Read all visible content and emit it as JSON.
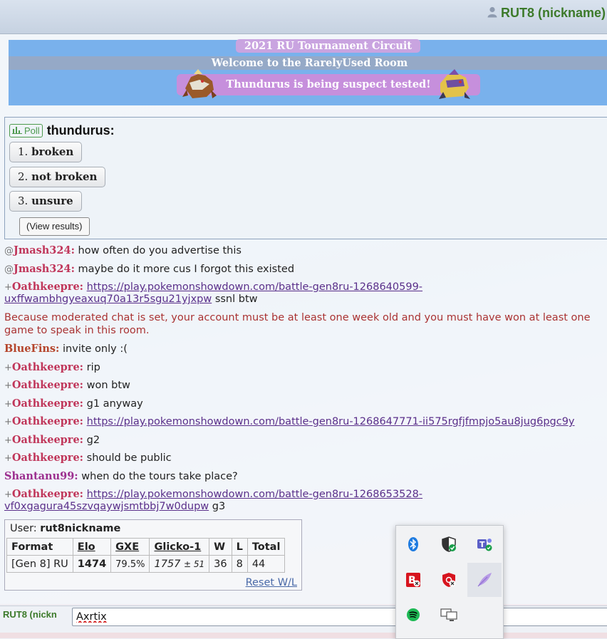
{
  "header": {
    "username": "RUT8 (nickname)"
  },
  "banner": {
    "line1": "2021 RU Tournament Circuit",
    "line2": "Welcome to the RarelyUsed Room",
    "line3": "Thundurus is being suspect tested!"
  },
  "poll": {
    "badge": "Poll",
    "question": "thundurus:",
    "options": [
      {
        "num": "1.",
        "label": "broken"
      },
      {
        "num": "2.",
        "label": "not broken"
      },
      {
        "num": "3.",
        "label": "unsure"
      }
    ],
    "view_results": "(View results)"
  },
  "chat": {
    "messages": [
      {
        "rank": "@",
        "user": "Jmash324:",
        "text": "how often do you advertise this"
      },
      {
        "rank": "@",
        "user": "Jmash324:",
        "text": "maybe do it more cus I forgot this existed"
      },
      {
        "rank": "+",
        "user": "Oathkeepre:",
        "link": "https://play.pokemonshowdown.com/battle-gen8ru-1268640599-",
        "link2": "uxffwambhgyeaxuq70a13r5sgu21yjxpw",
        "text": "ssnl btw"
      },
      {
        "rank": "+",
        "user": "Oathkeepre:",
        "text": "rip"
      },
      {
        "rank": "+",
        "user": "Oathkeepre:",
        "text": "won btw"
      },
      {
        "rank": "+",
        "user": "Oathkeepre:",
        "text": "g1 anyway"
      },
      {
        "rank": "+",
        "user": "Oathkeepre:",
        "link": "https://play.pokemonshowdown.com/battle-gen8ru-1268647771-ii575rgfjfmpjo5au8jug6pgc9y"
      },
      {
        "rank": "+",
        "user": "Oathkeepre:",
        "text": "g2"
      },
      {
        "rank": "+",
        "user": "Oathkeepre:",
        "text": "should be public"
      },
      {
        "rank": "",
        "user": "Shantanu99:",
        "text": "when do the tours take place?"
      },
      {
        "rank": "+",
        "user": "Oathkeepre:",
        "link": "https://play.pokemonshowdown.com/battle-gen8ru-1268653528-",
        "link2": "vf0xgagura45szvqaywjsmtbbj7w0dupw",
        "text": "g3"
      }
    ],
    "bluefins": {
      "user": "BlueFins:",
      "text": "invite only :("
    },
    "moderated_notice": "Because moderated chat is set, your account must be at least one week old and you must have won at least one game to speak in this room."
  },
  "user_stats": {
    "user_label": "User:",
    "user_value": "rut8nickname",
    "headers": [
      "Format",
      "Elo",
      "GXE",
      "Glicko-1",
      "W",
      "L",
      "Total"
    ],
    "row": {
      "format": "[Gen 8] RU",
      "elo": "1474",
      "gxe": "79.5%",
      "glicko": "1757",
      "glicko_dev": "± 51",
      "w": "36",
      "l": "8",
      "total": "44"
    },
    "reset": "Reset W/L"
  },
  "input": {
    "name": "RUT8 (nickn",
    "value": "Axrtix"
  },
  "colors": {
    "jmash": "#c0365a",
    "oath": "#c0365a",
    "bluefins": "#b5452c",
    "shantanu": "#9c2f8f",
    "accent_green": "#3c7a2a"
  }
}
